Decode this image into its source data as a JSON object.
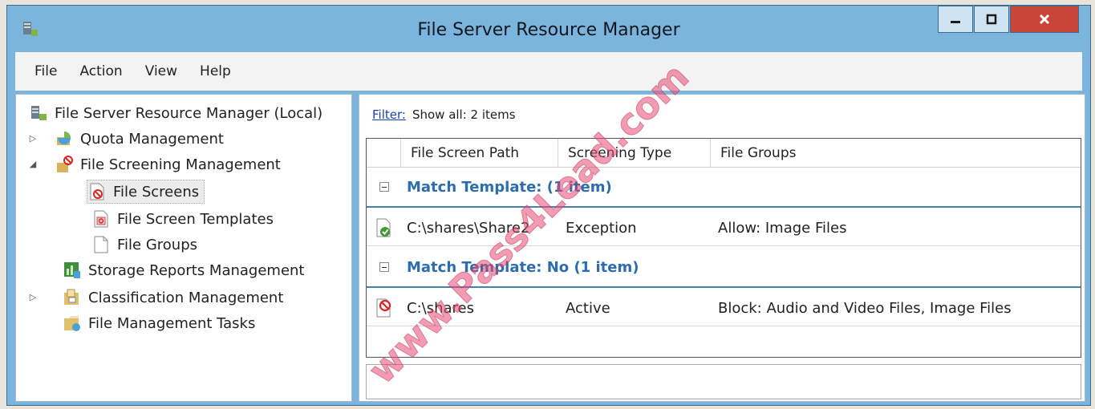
{
  "window": {
    "title": "File Server Resource Manager"
  },
  "menu": [
    {
      "label": "File"
    },
    {
      "label": "Action"
    },
    {
      "label": "View"
    },
    {
      "label": "Help"
    }
  ],
  "tree": {
    "root": "File Server Resource Manager (Local)",
    "items": [
      {
        "label": "Quota Management",
        "icon": "quota-icon"
      },
      {
        "label": "File Screening Management",
        "icon": "file-screening-icon"
      },
      {
        "label": "File Screens",
        "icon": "file-screens-icon",
        "selected": true
      },
      {
        "label": "File Screen Templates",
        "icon": "template-icon"
      },
      {
        "label": "File Groups",
        "icon": "file-groups-icon"
      },
      {
        "label": "Storage Reports Management",
        "icon": "storage-reports-icon"
      },
      {
        "label": "Classification Management",
        "icon": "classification-icon"
      },
      {
        "label": "File Management Tasks",
        "icon": "file-tasks-icon"
      }
    ]
  },
  "filter": {
    "link": "Filter:",
    "text": "Show all: 2 items"
  },
  "columns": [
    "File Screen Path",
    "Screening Type",
    "File Groups"
  ],
  "groups": [
    {
      "label": "Match Template: (1 item)",
      "rows": [
        {
          "path": "C:\\shares\\Share2",
          "type": "Exception",
          "groups": "Allow: Image Files",
          "icon": "exception-check-icon"
        }
      ]
    },
    {
      "label": "Match Template: No (1 item)",
      "rows": [
        {
          "path": "C:\\shares",
          "type": "Active",
          "groups": "Block: Audio and Video Files, Image Files",
          "icon": "blocked-screen-icon"
        }
      ]
    }
  ],
  "watermark": "www.Pass4Lead.com",
  "colors": {
    "frame": "#7bb4dc",
    "group_label": "#2c6cb0",
    "close_button": "#c9443a",
    "watermark": "#e84a74"
  }
}
